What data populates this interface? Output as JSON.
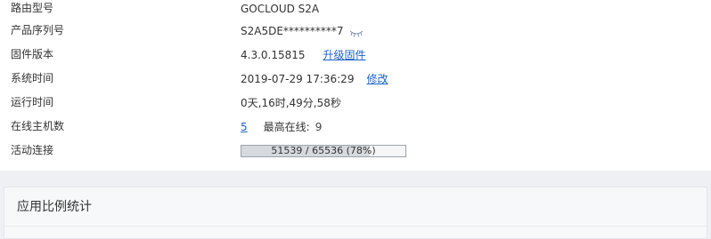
{
  "device_info": {
    "rows": [
      {
        "label": "路由型号",
        "value": "GOCLOUD S2A"
      },
      {
        "label": "产品序列号",
        "value": "S2A5DE**********7"
      },
      {
        "label": "固件版本",
        "value": "4.3.0.15815",
        "link": "升级固件"
      },
      {
        "label": "系统时间",
        "value": "2019-07-29 17:36:29",
        "link": "修改"
      },
      {
        "label": "运行时间",
        "value": "0天,16时,49分,58秒"
      },
      {
        "label": "在线主机数",
        "value": "5",
        "extra_label": "最高在线:",
        "extra_value": "9"
      },
      {
        "label": "活动连接",
        "progress_text": "51539 / 65536 (78%)",
        "progress_percent": 78
      }
    ]
  },
  "stats_panel": {
    "title": "应用比例统计"
  },
  "icons": {
    "serial_reveal": "eye-closed-icon"
  },
  "colors": {
    "link": "#1a63c6",
    "progress_fill": "#d6d9dd"
  }
}
